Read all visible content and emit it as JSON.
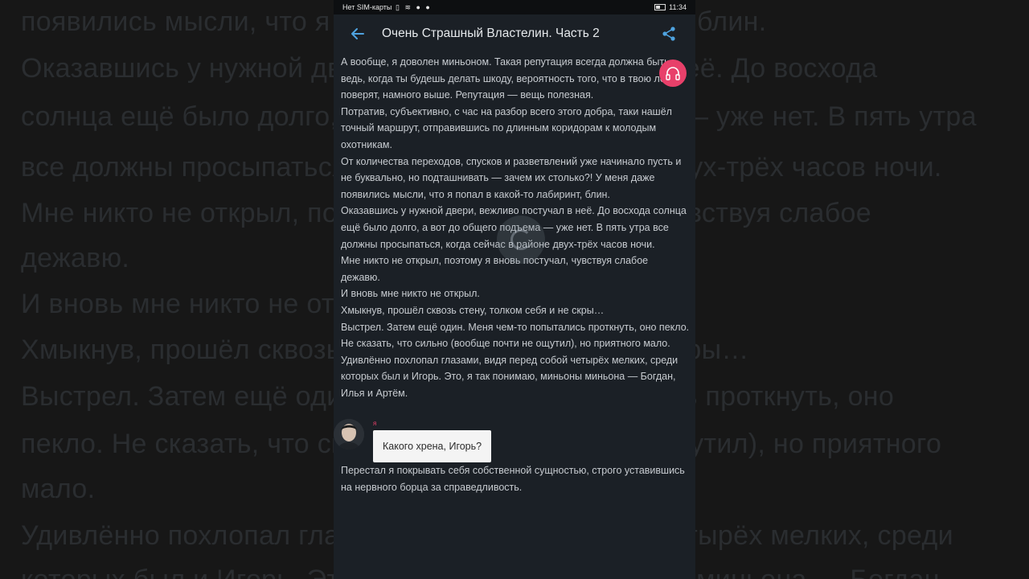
{
  "background_lines": [
    "появились мысли, что я попал в какой-то лабиринт, блин.",
    "Оказавшись у нужной двери, вежливо постучал в неё. До восхода",
    "солнца ещё было долго, а вот до общего подъема — уже нет. В пять утра",
    "все должны просыпаться, когда сейчас в районе двух-трёх часов ночи.",
    "Мне никто не открыл, поэтому я вновь постучал, чувствуя слабое",
    "дежавю.",
    "И вновь мне никто не открыл.",
    "Хмыкнув, прошёл сквозь стену, толком себя и не скры…",
    "Выстрел. Затем ещё один. Меня чем-то попытались проткнуть, оно",
    "пекло. Не сказать, что сильно (вообще почти не ощутил), но приятного",
    "мало.",
    "Удивлённо похлопал глазами, видя перед собой четырёх мелких, среди",
    "которых был и Игорь. Это, я так понимаю, миньоны миньона — Богдан,"
  ],
  "status_bar": {
    "carrier": "Нет SIM-карты",
    "time": "11:34"
  },
  "app_bar": {
    "title": "Очень Страшный Властелин. Часть 2",
    "back_icon": "arrow-left-icon",
    "share_icon": "share-icon"
  },
  "audio_button": {
    "icon": "headphones-icon"
  },
  "story": {
    "paragraphs": [
      "А вообще, я доволен миньоном. Такая репутация всегда должна быть, ведь, когда ты будешь делать шкоду, вероятность того, что в твою ложь поверят, намного выше. Репутация — вещь полезная.",
      "Потратив, субъективно, с час на разбор всего этого добра, таки нашёл точный маршрут, отправившись по длинным коридорам к молодым охотникам.",
      "От количества переходов, спусков и разветвлений уже начинало пусть и не буквально, но подташнивать — зачем их столько?! У меня даже появились мысли, что я попал в какой-то лабиринт, блин.",
      "Оказавшись у нужной двери, вежливо постучал в неё. До восхода солнца ещё было долго, а вот до общего подъема — уже нет. В пять утра все должны просыпаться, когда сейчас в районе двух-трёх часов ночи.",
      "Мне никто не открыл, поэтому я вновь постучал, чувствуя слабое дежавю.",
      "И вновь мне никто не открыл.",
      "Хмыкнув, прошёл сквозь стену, толком себя и не скры…",
      "Выстрел. Затем ещё один. Меня чем-то попытались проткнуть, оно пекло. Не сказать, что сильно (вообще почти не ощутил), но приятного мало.",
      "Удивлённо похлопал глазами, видя перед собой четырёх мелких, среди которых был и Игорь. Это, я так понимаю, миньоны миньона — Богдан, Илья и Артём."
    ],
    "dialog": {
      "speaker": "я",
      "text": "Какого хрена, Игорь?"
    },
    "after_dialog": "Перестал я покрывать себя собственной сущностью, строго уставившись на нервного борца за справедливость."
  },
  "colors": {
    "accent": "#4fa3e0",
    "fab": "#e8406a",
    "reader_bg": "#1b2026",
    "text": "#c7cbd0"
  }
}
